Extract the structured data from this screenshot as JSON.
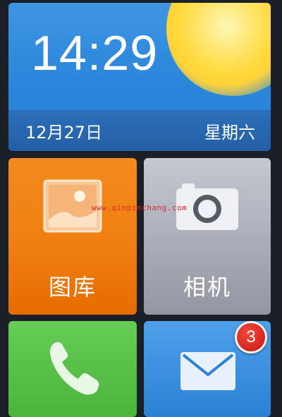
{
  "clock_widget": {
    "time": "14:29",
    "date": "12月27日",
    "weekday": "星期六"
  },
  "apps": {
    "gallery": {
      "label": "图库",
      "icon": "gallery-icon"
    },
    "camera": {
      "label": "相机",
      "icon": "camera-icon"
    },
    "phone": {
      "icon": "phone-icon"
    },
    "messages": {
      "icon": "mail-icon",
      "badge_count": "3"
    }
  },
  "watermark": "www.qinpinchang.com",
  "colors": {
    "gallery_tile": "#f07f11",
    "camera_tile": "#aeb2bc",
    "phone_tile": "#4bb43c",
    "messages_tile": "#2b81d4",
    "badge": "#d9271f",
    "watermark": "#e0252d"
  }
}
